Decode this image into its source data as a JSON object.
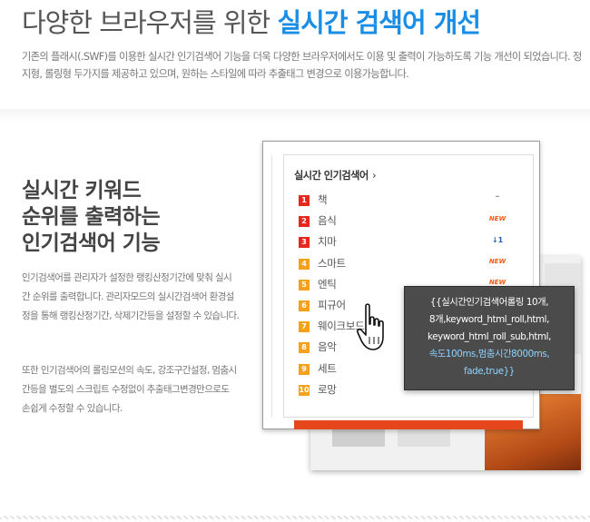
{
  "header": {
    "title_plain": "다양한 브라우저를 위한 ",
    "title_accent": "실시간 검색어 개선",
    "description": "기존의 플래시(.SWF)를 이용한 실시간 인기검색어 기능을 더욱 다양한 브라우저에서도 이용 및 출력이 가능하도록 기능 개선이 되었습니다. 정지형, 롤링형 두가지를 제공하고 있으며, 원하는 스타일에 따라 추출태그 변경으로 이용가능합니다."
  },
  "section": {
    "title": "실시간 키워드\n순위를 출력하는\n인기검색어 기능",
    "paragraph1": "인기검색어를 관리자가 설정한 랭킹산정기간에 맞춰 실시간 순위를 출력합니다. 관리자모드의 실시간검색어 환경설정을 통해 랭킹산정기간, 삭제기간등을 설정할 수 있습니다.",
    "paragraph2": "또한 인기검색어의 롤링모션의 속도, 강조구간설정, 멈춤시간등을 별도의 스크립트 수정없이 추출태그변경만으로도 손쉽게 수정할 수 있습니다."
  },
  "widget": {
    "title": "실시간 인기검색어",
    "chevron": "›",
    "items": [
      {
        "rank": "1",
        "keyword": "책",
        "status": "–",
        "status_type": "same"
      },
      {
        "rank": "2",
        "keyword": "음식",
        "status": "NEW",
        "status_type": "new"
      },
      {
        "rank": "3",
        "keyword": "치마",
        "status": "↓1",
        "status_type": "up"
      },
      {
        "rank": "4",
        "keyword": "스마트",
        "status": "NEW",
        "status_type": "new"
      },
      {
        "rank": "5",
        "keyword": "엔틱",
        "status": "NEW",
        "status_type": "new"
      },
      {
        "rank": "6",
        "keyword": "피규어",
        "status": "",
        "status_type": "none"
      },
      {
        "rank": "7",
        "keyword": "웨이크보드",
        "status": "",
        "status_type": "none"
      },
      {
        "rank": "8",
        "keyword": "음악",
        "status": "",
        "status_type": "none"
      },
      {
        "rank": "9",
        "keyword": "세트",
        "status": "",
        "status_type": "none"
      },
      {
        "rank": "10",
        "keyword": "로망",
        "status": "",
        "status_type": "none"
      }
    ]
  },
  "tooltip": {
    "line1": "{{실시간인기검색어롤링 10개,",
    "line2": "8개,keyword_html_roll,html,",
    "line3": "keyword_html_roll_sub,html,",
    "line4": "속도100ms,멈춤시간8000ms,",
    "line5": "fade,true}}"
  },
  "colors": {
    "accent": "#1a8ee6",
    "rank_top3": "#e8261c",
    "rank_rest": "#f5a11a",
    "new_badge": "#f05a14",
    "tooltip_bg": "#4b4b4b",
    "tooltip_highlight": "#8cd3ff"
  },
  "icons": {
    "cursor": "hand-pointer-icon"
  }
}
